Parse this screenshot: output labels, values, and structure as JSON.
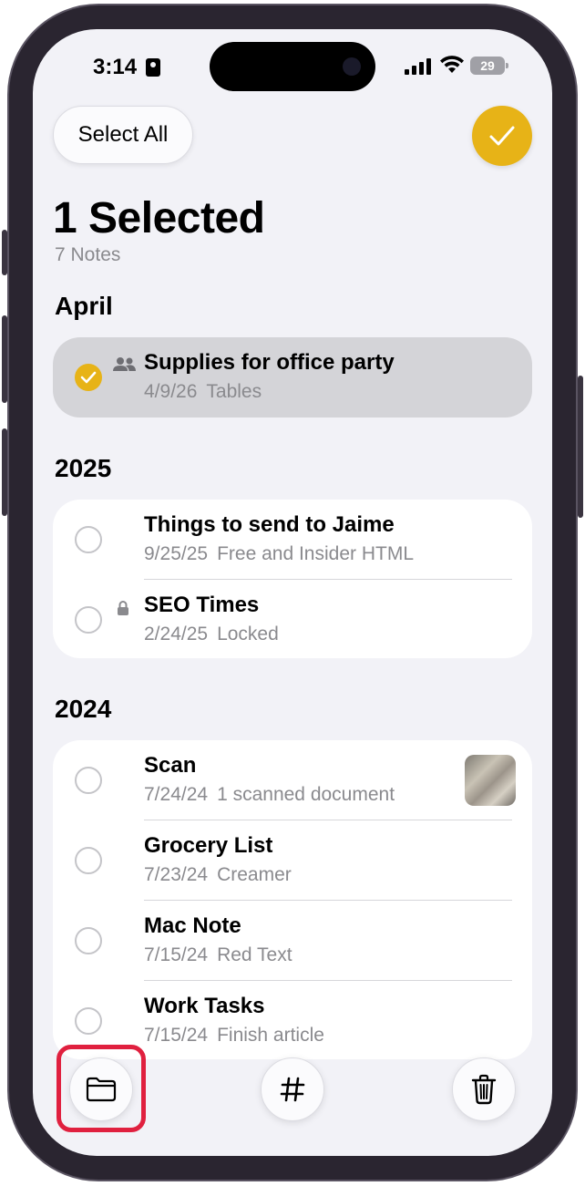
{
  "status_bar": {
    "time": "3:14",
    "battery": "29"
  },
  "header": {
    "select_all_label": "Select All",
    "title": "1 Selected",
    "subtitle": "7 Notes"
  },
  "sections": [
    {
      "title": "April",
      "notes": [
        {
          "title": "Supplies for office party",
          "date": "4/9/26",
          "preview": "Tables",
          "selected": true,
          "icon": "shared-people-icon"
        }
      ]
    },
    {
      "title": "2025",
      "notes": [
        {
          "title": "Things to send to Jaime",
          "date": "9/25/25",
          "preview": "Free and Insider HTML",
          "selected": false
        },
        {
          "title": "SEO Times",
          "date": "2/24/25",
          "preview": "Locked",
          "selected": false,
          "icon": "lock-icon"
        }
      ]
    },
    {
      "title": "2024",
      "notes": [
        {
          "title": "Scan",
          "date": "7/24/24",
          "preview": "1 scanned document",
          "selected": false,
          "thumbnail": true
        },
        {
          "title": "Grocery List",
          "date": "7/23/24",
          "preview": "Creamer",
          "selected": false
        },
        {
          "title": "Mac Note",
          "date": "7/15/24",
          "preview": "Red Text",
          "selected": false
        },
        {
          "title": "Work Tasks",
          "date": "7/15/24",
          "preview": "Finish article",
          "selected": false
        }
      ]
    }
  ],
  "toolbar": {
    "buttons": [
      "folder-icon",
      "hashtag-icon",
      "trash-icon"
    ]
  },
  "colors": {
    "accent": "#e7b317",
    "highlight": "#e0203f",
    "background": "#f2f2f7"
  }
}
